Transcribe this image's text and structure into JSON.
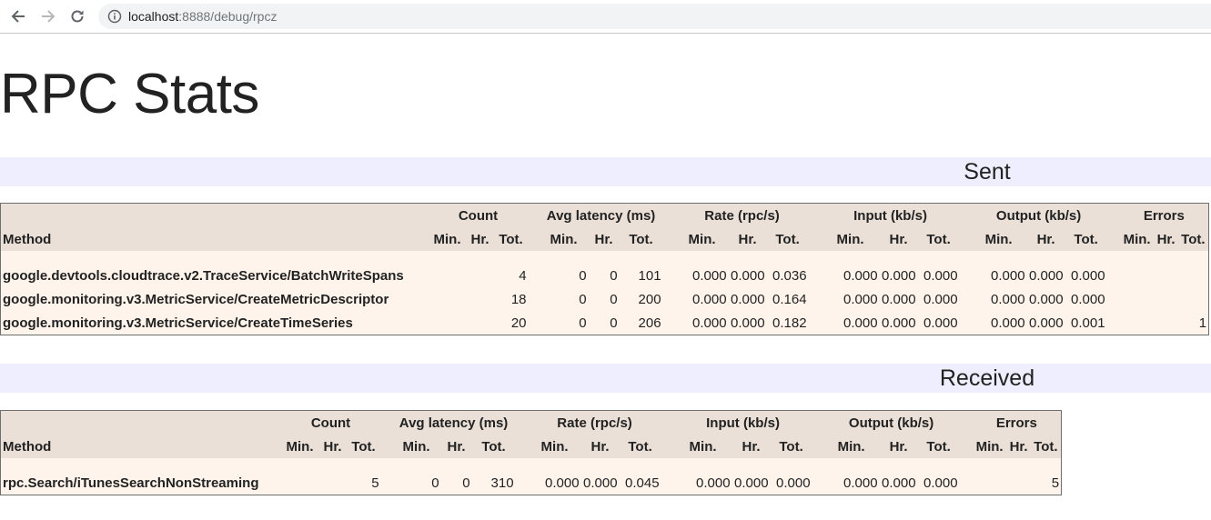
{
  "browser": {
    "url_host": "localhost",
    "url_path": ":8888/debug/rpcz"
  },
  "page": {
    "title": "RPC Stats"
  },
  "column_groups": [
    "Count",
    "Avg latency (ms)",
    "Rate (rpc/s)",
    "Input (kb/s)",
    "Output (kb/s)",
    "Errors"
  ],
  "column_headers": {
    "method": "Method",
    "min": "Min.",
    "hr": "Hr.",
    "tot": "Tot."
  },
  "sections": [
    {
      "title": "Sent",
      "rows": [
        {
          "method": "google.devtools.cloudtrace.v2.TraceService/BatchWriteSpans",
          "count": [
            "",
            "",
            "4"
          ],
          "latency": [
            "0",
            "0",
            "101"
          ],
          "rate": [
            "0.000",
            "0.000",
            "0.036"
          ],
          "input": [
            "0.000",
            "0.000",
            "0.000"
          ],
          "output": [
            "0.000",
            "0.000",
            "0.000"
          ],
          "errors": [
            "",
            "",
            ""
          ]
        },
        {
          "method": "google.monitoring.v3.MetricService/CreateMetricDescriptor",
          "count": [
            "",
            "",
            "18"
          ],
          "latency": [
            "0",
            "0",
            "200"
          ],
          "rate": [
            "0.000",
            "0.000",
            "0.164"
          ],
          "input": [
            "0.000",
            "0.000",
            "0.000"
          ],
          "output": [
            "0.000",
            "0.000",
            "0.000"
          ],
          "errors": [
            "",
            "",
            ""
          ]
        },
        {
          "method": "google.monitoring.v3.MetricService/CreateTimeSeries",
          "count": [
            "",
            "",
            "20"
          ],
          "latency": [
            "0",
            "0",
            "206"
          ],
          "rate": [
            "0.000",
            "0.000",
            "0.182"
          ],
          "input": [
            "0.000",
            "0.000",
            "0.000"
          ],
          "output": [
            "0.000",
            "0.000",
            "0.001"
          ],
          "errors": [
            "",
            "",
            "1"
          ]
        }
      ]
    },
    {
      "title": "Received",
      "rows": [
        {
          "method": "rpc.Search/iTunesSearchNonStreaming",
          "count": [
            "",
            "",
            "5"
          ],
          "latency": [
            "0",
            "0",
            "310"
          ],
          "rate": [
            "0.000",
            "0.000",
            "0.045"
          ],
          "input": [
            "0.000",
            "0.000",
            "0.000"
          ],
          "output": [
            "0.000",
            "0.000",
            "0.000"
          ],
          "errors": [
            "",
            "",
            "5"
          ]
        }
      ]
    }
  ]
}
